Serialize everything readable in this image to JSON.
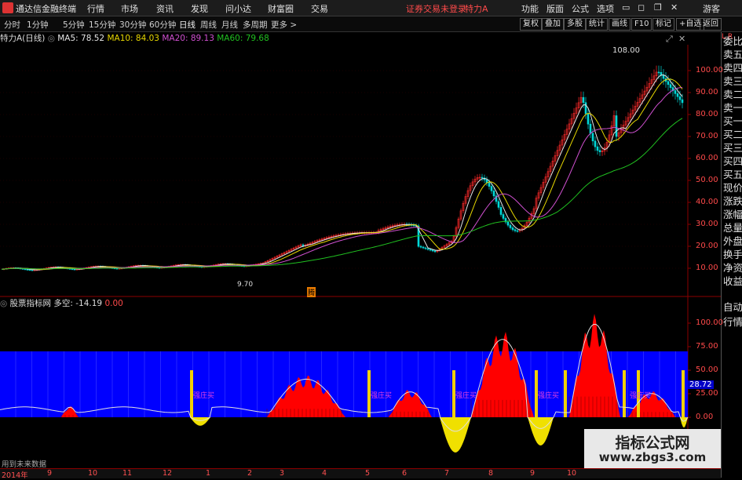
{
  "app": {
    "title": "通达信金融终端",
    "menu": [
      "行情",
      "市场",
      "资讯",
      "发现",
      "问小达",
      "财富圈",
      "交易"
    ],
    "notice": "证券交易未登录",
    "stock_name": "特力A",
    "right_menu": [
      "功能",
      "版面",
      "公式",
      "选项"
    ],
    "guest": "游客"
  },
  "periods": [
    "分时",
    "1分钟",
    "5分钟",
    "15分钟",
    "30分钟",
    "60分钟",
    "日线",
    "周线",
    "月线",
    "多周期",
    "更多 >"
  ],
  "toolbar_right": [
    "复权",
    "叠加",
    "多股",
    "统计",
    "画线",
    "F10",
    "标记",
    "+自选",
    "返回"
  ],
  "ma": {
    "name": "特力A(日线)",
    "ma5": "MA5: 78.52",
    "ma10": "MA10: 84.03",
    "ma20": "MA20: 89.13",
    "ma60": "MA60: 79.68"
  },
  "colors": {
    "ma5": "#e6e6e6",
    "ma10": "#e8d800",
    "ma20": "#d050d0",
    "ma60": "#20c020",
    "up": "#ff2a2a",
    "down": "#00d8d8",
    "axis": "#8b0000",
    "label": "#ff4a4a",
    "band": "#0000ff",
    "bars": "#ff0000"
  },
  "annotations": {
    "high": "108.00",
    "low": "9.70",
    "marker": "腾"
  },
  "main_y_ticks": [
    "100.00",
    "90.00",
    "80.00",
    "70.00",
    "60.00",
    "50.00",
    "40.00",
    "30.00",
    "20.00",
    "10.00"
  ],
  "sub": {
    "title": "股票指标网",
    "label": "多空: -14.19",
    "value": "0.00",
    "y_ticks": [
      "100.00",
      "75.00",
      "50.00",
      "25.00",
      "0.00"
    ],
    "current": "28.72",
    "signal_text": "强庄买",
    "footer": "用到未来数据"
  },
  "side_panel": [
    "委比",
    "卖五",
    "卖四",
    "卖三",
    "卖二",
    "卖一",
    "买一",
    "买二",
    "买三",
    "买四",
    "买五",
    "现价",
    "涨跌",
    "涨幅",
    "总量",
    "外盘",
    "换手",
    "净资",
    "收益"
  ],
  "side_bottom": [
    "自动",
    "行情"
  ],
  "dates": [
    "2014年",
    "9",
    "10",
    "11",
    "12",
    "1",
    "2",
    "3",
    "4",
    "5",
    "6",
    "7",
    "8",
    "9",
    "10"
  ],
  "watermark": {
    "cn": "指标公式网",
    "url": "www.zbgs3.com"
  }
}
